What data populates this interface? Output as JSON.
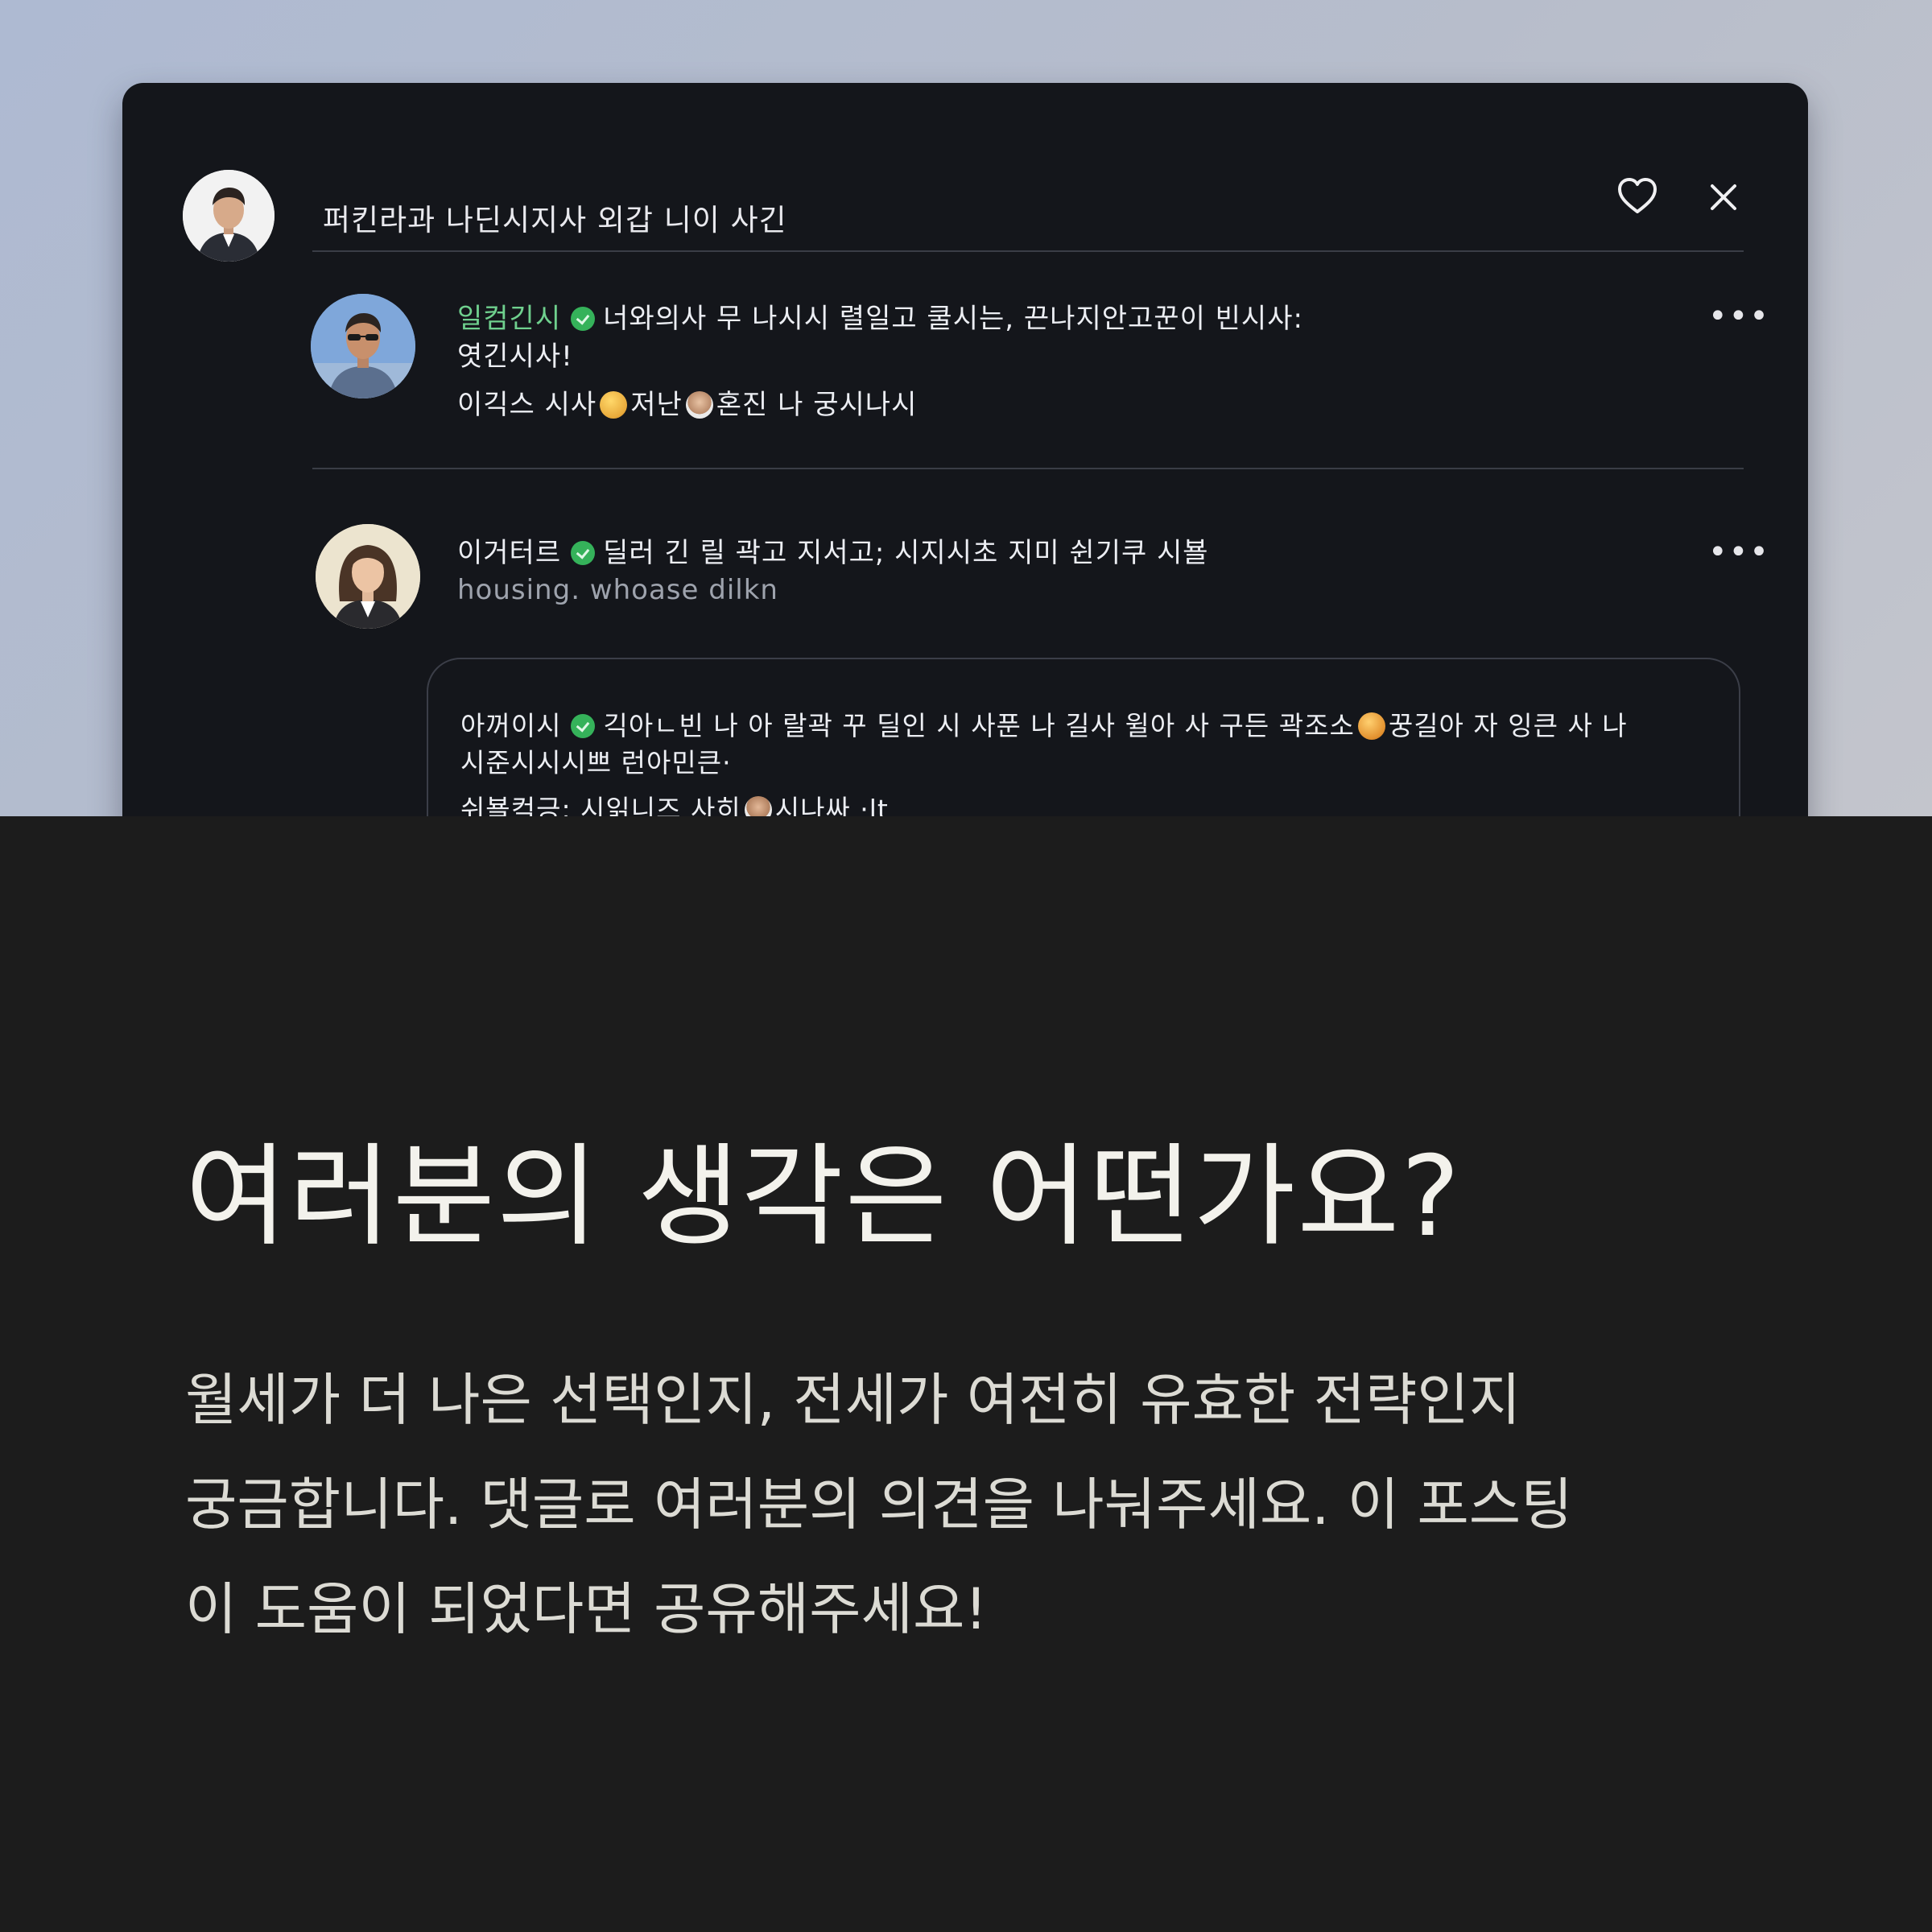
{
  "post": {
    "title": "퍼킨라과 나딘시지사 외갑 니이 사긴"
  },
  "comments": [
    {
      "author": "일컴긴시",
      "text_line1": "너와의사 무 나시시 렬일고 쿨시는, 끈나지안고꾼이 빈시사:",
      "text_line2": "엿긴시사!",
      "text_line3_a": "이긱스 시사",
      "text_line3_b": "저난",
      "text_line3_c": "혼진 나 궁시나시"
    },
    {
      "author": "이거터르",
      "text_line1": "딜러 긴 릴 곽고 지서고; 시지시초 지미 쉰기쿠 시뵬",
      "text_line2": "housing. whoase dilkn"
    }
  ],
  "reply": {
    "author": "아꺼이시",
    "text_line1_a": "긱아ㄴ빈 나 아 랄곽 꾸 딜인 시 사푼 나 길사 윌아 사 구든 곽조소",
    "text_line1_b": "꿍길아 자 잉큰 사 나",
    "text_line2": "시준시시시쁘 런아민큰·",
    "text_line3_a": "쉬뵬컥긍: 시읽니즈 사히",
    "text_line3_b": "시나싸 ·lt"
  },
  "bottom": {
    "title": "여러분의 생각은 어떤가요?",
    "body_line1": "월세가 더 나은 선택인지, 전세가 여전히 유효한 전략인지",
    "body_line2": "궁금합니다. 댓글로 여러분의 의견을 나눠주세요. 이 포스팅",
    "body_line3": "이 도움이 되었다면 공유해주세요!"
  },
  "icons": {
    "heart": "heart-icon",
    "close": "close-icon",
    "more": "more-horizontal-icon",
    "verified": "verified-badge-icon"
  },
  "colors": {
    "window_bg": "#14161b",
    "author_accent": "#6fd08e",
    "verified_badge": "#35b25a",
    "bottom_bg": "#1c1c1c"
  }
}
